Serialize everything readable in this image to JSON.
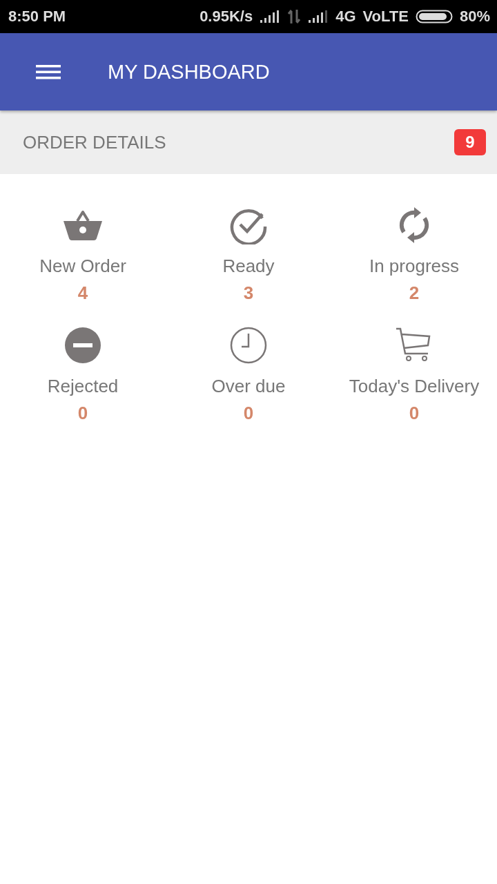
{
  "status_bar": {
    "time": "8:50 PM",
    "speed": "0.95K/s",
    "network": "4G",
    "volte": "VoLTE",
    "battery": "80%"
  },
  "app_bar": {
    "title": "MY DASHBOARD"
  },
  "section": {
    "title": "ORDER DETAILS",
    "badge": "9"
  },
  "tiles": [
    {
      "kind": "basket",
      "label": "New Order",
      "count": "4"
    },
    {
      "kind": "check",
      "label": "Ready",
      "count": "3"
    },
    {
      "kind": "sync",
      "label": "In progress",
      "count": "2"
    },
    {
      "kind": "minus",
      "label": "Rejected",
      "count": "0"
    },
    {
      "kind": "clock",
      "label": "Over due",
      "count": "0"
    },
    {
      "kind": "cart",
      "label": "Today's Delivery",
      "count": "0"
    }
  ]
}
